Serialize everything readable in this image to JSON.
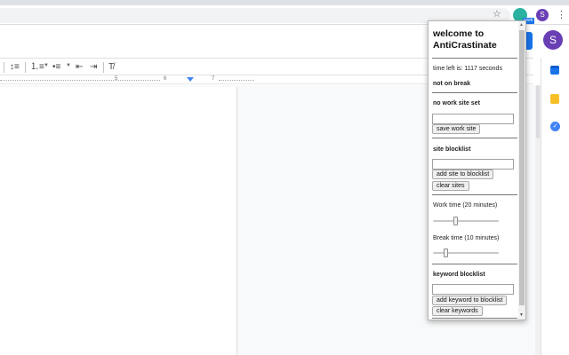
{
  "browser": {
    "profile_initial": "S",
    "extension_badge": "work",
    "accent": "#1a73e8"
  },
  "docs": {
    "avatar_initial": "S",
    "ruler_ticks": [
      "5",
      "6",
      "7"
    ]
  },
  "popup": {
    "title": "welcome to AntiCrastinate",
    "time_left": "time left is: 1117 seconds",
    "break_status": "not on break",
    "work_site_heading": "no work site set",
    "work_site_value": "",
    "save_work_site_label": "save work site",
    "blocklist_heading": "site blocklist",
    "blocklist_value": "",
    "add_site_label": "add site to blocklist",
    "clear_sites_label": "clear sites",
    "work_time_label": "Work time (20 minutes)",
    "work_time_value": 20,
    "work_time_fraction": 0.33,
    "break_time_label": "Break time (10 minutes)",
    "break_time_value": 10,
    "break_time_fraction": 0.17,
    "keyword_heading": "keyword blocklist",
    "keyword_value": "",
    "add_keyword_label": "add keyword to blocklist",
    "clear_keywords_label": "clear keywords"
  }
}
